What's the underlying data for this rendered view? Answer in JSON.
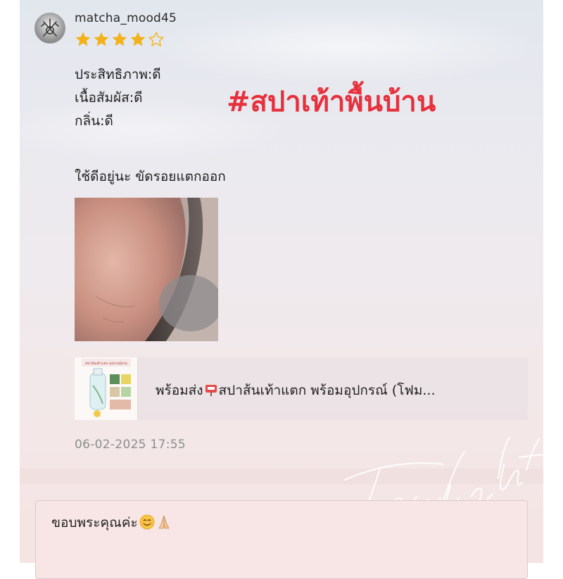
{
  "review": {
    "username": "matcha_mood45",
    "rating": 4,
    "max_rating": 5,
    "attributes": [
      "ประสิทธิภาพ:ดี",
      "เนื้อสัมผัส:ดี",
      "กลิ่น:ดี"
    ],
    "comment": "ใช้ดีอยู่นะ ขัดรอยแตกออก",
    "timestamp": "06-02-2025 17:55"
  },
  "hashtag": "#สปาเท้าพื้นบ้าน",
  "product": {
    "title_prefix": "พร้อมส่ง",
    "title_suffix": "สปาส้นเท้าแตก พร้อมอุปกรณ์ (โฟม...",
    "thumbnail_caption": "สปาส้นเท้าแตก อุปกรณ์ครบ"
  },
  "reply": {
    "text": "ขอบพระคุณค่ะ"
  },
  "watermark": "Twilight",
  "colors": {
    "star": "#f2b21c",
    "hashtag": "#e8303c",
    "timestamp": "#8d8d8d"
  },
  "icons": [
    "star-filled-icon",
    "star-outline-icon",
    "mailbox-emoji-icon",
    "smile-emoji-icon",
    "folded-hands-emoji-icon"
  ]
}
